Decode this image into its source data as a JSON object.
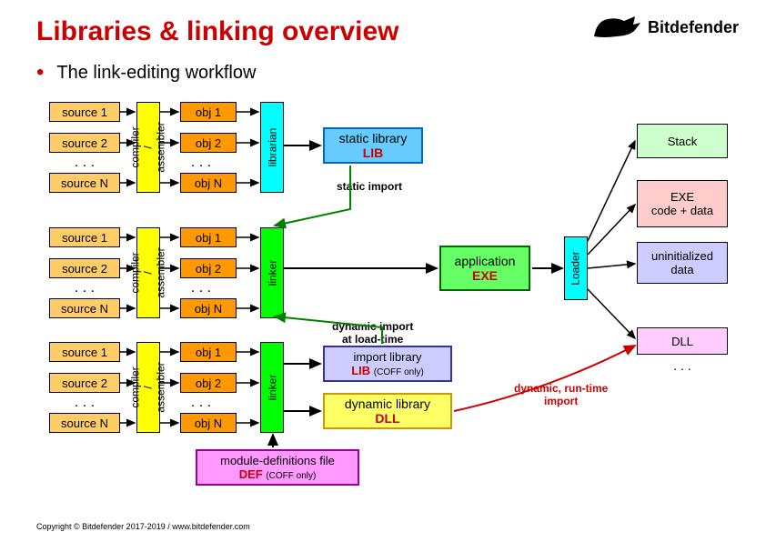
{
  "header": {
    "title": "Libraries & linking overview",
    "logo_text": "Bitdefender"
  },
  "bullet": {
    "text": "The link-editing workflow"
  },
  "groups": [
    {
      "sources": [
        "source 1",
        "source 2",
        "source N"
      ],
      "objs": [
        "obj 1",
        "obj 2",
        "obj N"
      ],
      "dots": ". . ."
    },
    {
      "sources": [
        "source 1",
        "source 2",
        "source N"
      ],
      "objs": [
        "obj 1",
        "obj 2",
        "obj N"
      ],
      "dots": ". . ."
    },
    {
      "sources": [
        "source 1",
        "source 2",
        "source N"
      ],
      "objs": [
        "obj 1",
        "obj 2",
        "obj N"
      ],
      "dots": ". . ."
    }
  ],
  "vlabels": {
    "compiler": "compiler\n/ assembler",
    "librarian": "librarian",
    "linker": "linker",
    "loader": "Loader"
  },
  "outputs": {
    "static_lib_1": "static library",
    "static_lib_2": "LIB",
    "app_1": "application",
    "app_2": "EXE",
    "implib_1": "import library",
    "implib_2": "LIB",
    "implib_coff": "(COFF only)",
    "dynlib_1": "dynamic library",
    "dynlib_2": "DLL",
    "def_1": "module-definitions file",
    "def_2": "DEF",
    "def_coff": "(COFF only)"
  },
  "mem": {
    "stack": "Stack",
    "code": "EXE\ncode + data",
    "data": "uninitialized\ndata",
    "dll": "DLL",
    "dots": ". . ."
  },
  "ann": {
    "static_import": "static import",
    "dyn_load": "dynamic import\nat load-time",
    "dyn_run": "dynamic, run-time\nimport"
  },
  "footer": "Copyright © Bitdefender 2017-2019  /  www.bitdefender.com"
}
